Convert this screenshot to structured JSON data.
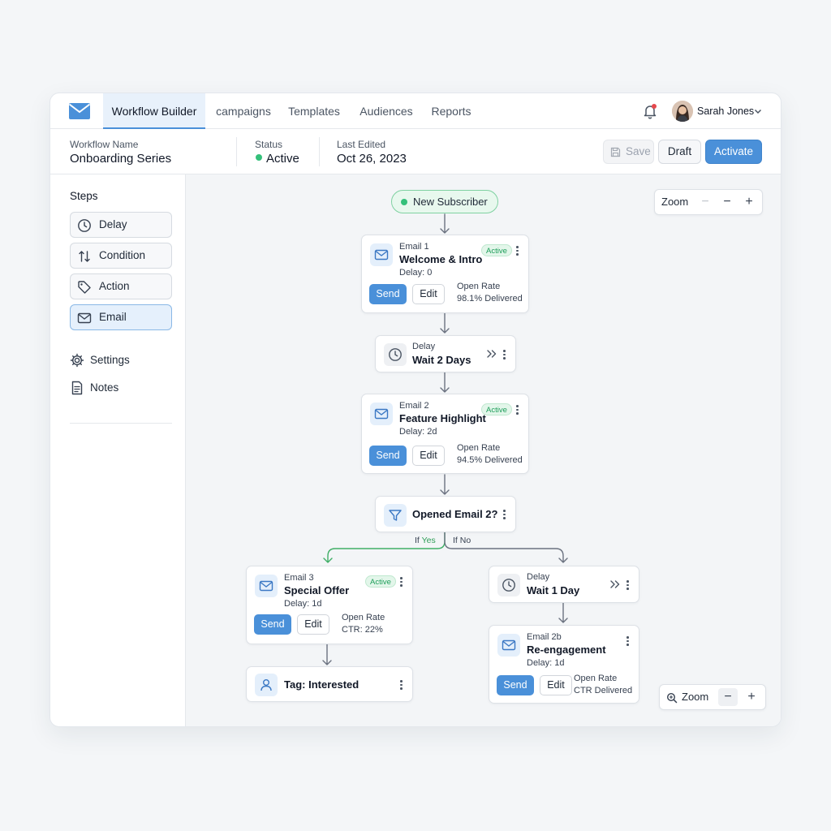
{
  "topnav": {
    "tabs": [
      {
        "label": "Workflow Builder",
        "active": true
      },
      {
        "label": "campaigns"
      },
      {
        "label": "Templates"
      },
      {
        "label": "Audiences"
      },
      {
        "label": "Reports"
      }
    ],
    "user": {
      "name": "Sarah Jones"
    },
    "notification_dot": true
  },
  "meta": {
    "workflow_name_label": "Workflow Name",
    "workflow_name": "Onboarding Series",
    "status_label": "Status",
    "status": "Active",
    "last_edited_label": "Last Edited",
    "last_edited": "Oct 26, 2023",
    "buttons": {
      "save": "Save",
      "draft": "Draft",
      "activate": "Activate"
    }
  },
  "sidebar": {
    "title": "Steps",
    "steps": [
      {
        "label": "Delay",
        "icon": "clock-icon"
      },
      {
        "label": "Condition",
        "icon": "split-arrows-icon"
      },
      {
        "label": "Action",
        "icon": "tag-icon"
      },
      {
        "label": "Email",
        "icon": "mail-icon",
        "active": true
      }
    ],
    "links": [
      {
        "label": "Settings",
        "icon": "gear-icon"
      },
      {
        "label": "Notes",
        "icon": "notes-icon"
      }
    ]
  },
  "canvas": {
    "trigger": "New Subscriber",
    "email1": {
      "kind": "Email 1",
      "title": "Welcome & Intro",
      "delay": "Delay: 0",
      "badge": "Active",
      "send": "Send",
      "edit": "Edit",
      "stat1": "Open Rate",
      "stat2": "98.1% Delivered"
    },
    "delay1": {
      "kind": "Delay",
      "title": "Wait 2 Days"
    },
    "email2": {
      "kind": "Email 2",
      "title": "Feature Highlight",
      "delay": "Delay: 2d",
      "badge": "Active",
      "send": "Send",
      "edit": "Edit",
      "stat1": "Open Rate",
      "stat2": "94.5% Delivered"
    },
    "condition": {
      "title": "Opened Email 2?"
    },
    "branch": {
      "yes_prefix": "If ",
      "yes": "Yes",
      "no": "If No"
    },
    "email3": {
      "kind": "Email 3",
      "title": "Special Offer",
      "delay": "Delay: 1d",
      "badge": "Active",
      "send": "Send",
      "edit": "Edit",
      "stat1": "Open Rate",
      "stat2": "CTR: 22%"
    },
    "tag": {
      "title": "Tag: Interested"
    },
    "delay2": {
      "kind": "Delay",
      "title": "Wait 1 Day"
    },
    "email2b": {
      "kind": "Email 2b",
      "title": "Re-engagement",
      "delay": "Delay: 1d",
      "send": "Send",
      "edit": "Edit",
      "stat1": "Open Rate",
      "stat2": "CTR Delivered"
    },
    "zoom_top": "Zoom",
    "zoom_bottom": "Zoom"
  },
  "colors": {
    "accent": "#4a90d9",
    "success": "#34c07a",
    "yes_branch": "#3fae66",
    "notification": "#e5484d"
  }
}
